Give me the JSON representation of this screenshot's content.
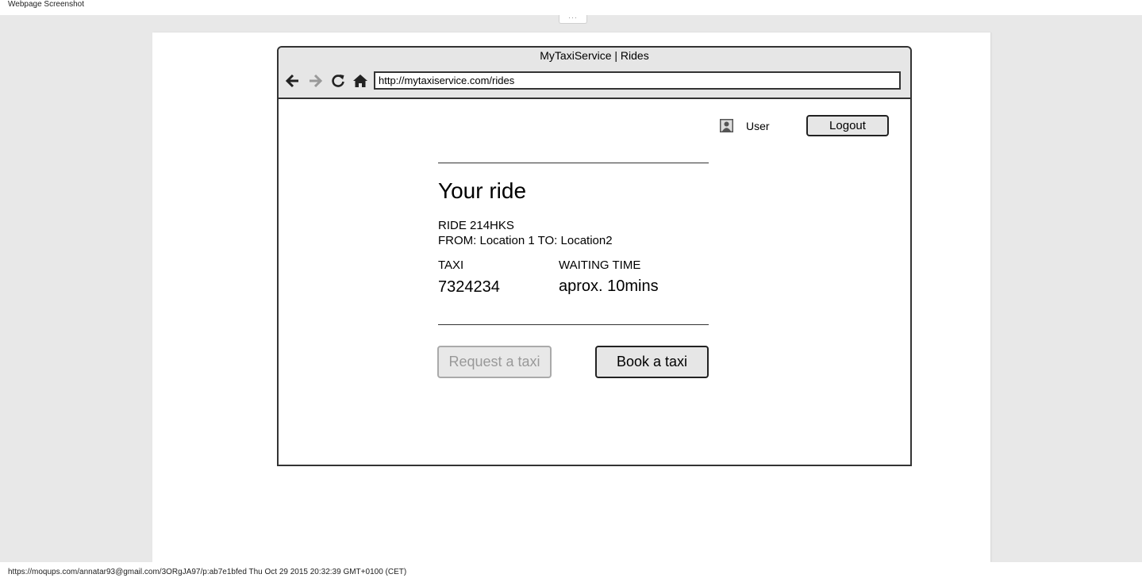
{
  "page_label": "Webpage Screenshot",
  "handle_glyph": "···",
  "browser": {
    "window_title": "MyTaxiService | Rides",
    "url": "http://mytaxiservice.com/rides",
    "nav_icons": [
      "back-arrow-icon",
      "forward-arrow-icon",
      "reload-icon",
      "home-icon"
    ]
  },
  "header": {
    "user_label": "User",
    "logout_label": "Logout"
  },
  "ride": {
    "heading": "Your ride",
    "ride_id": "RIDE 214HKS",
    "route": "FROM: Location 1 TO: Location2",
    "taxi_label": "TAXI",
    "taxi_value": "7324234",
    "waiting_label": "WAITING TIME",
    "waiting_value": "aprox. 10mins"
  },
  "actions": {
    "request_label": "Request a taxi",
    "book_label": "Book a taxi"
  },
  "footer": {
    "text": "https://moqups.com/annatar93@gmail.com/3ORgJA97/p:ab7e1bfed Thu Oct 29 2015 20:32:39 GMT+0100 (CET)"
  },
  "colors": {
    "background": "#e8e8e8",
    "chrome": "#e6e6e6",
    "border": "#333333",
    "disabled_text": "#999999",
    "forward_disabled": "#999999"
  }
}
